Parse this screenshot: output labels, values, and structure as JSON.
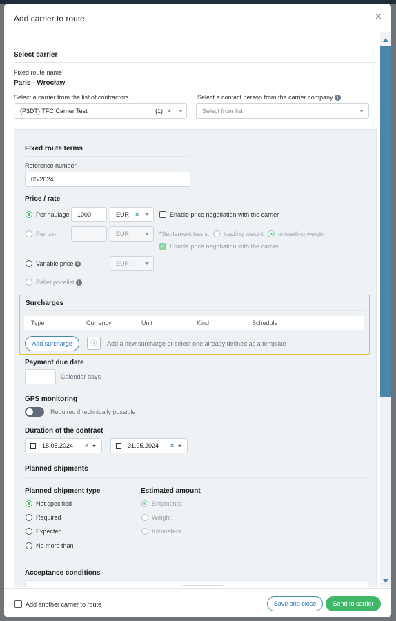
{
  "modal": {
    "title": "Add carrier to route",
    "close": "×"
  },
  "select_carrier": {
    "heading": "Select carrier",
    "route_name_label": "Fixed route name",
    "route_name": "Paris - Wrocław",
    "carrier_label": "Select a carrier from the list of contractors",
    "carrier_value": "(P3DT) TFC Carrier Test",
    "carrier_count": "(1)",
    "contact_label": "Select a contact person from the carrier company",
    "contact_placeholder": "Select from list"
  },
  "terms": {
    "heading": "Fixed route terms",
    "ref_label": "Reference number",
    "ref_value": "05/2024",
    "price_heading": "Price / rate",
    "per_haulage": "Per haulage",
    "per_haulage_value": "1000",
    "currency": "EUR",
    "enable_negotiation": "Enable price negotiation with the carrier",
    "per_ton": "Per ton",
    "settlement_basis": "Settlement basis:",
    "loading_weight": "loading weight",
    "unloading_weight": "unloading weight",
    "enable_negotiation_2": "Enable price negotiation with the carrier",
    "variable_price": "Variable price",
    "pallet_pricelist": "Pallet pricelist"
  },
  "surcharges": {
    "heading": "Surcharges",
    "columns": [
      "Type",
      "Currency",
      "Unit",
      "Kind",
      "Schedule"
    ],
    "add_button": "Add surcharge",
    "hint": "Add a new surcharge or select one already defined as a template"
  },
  "payment": {
    "heading": "Payment due date",
    "unit": "Calendar days"
  },
  "gps": {
    "heading": "GPS monitoring",
    "toggle_label": "Required if technically possible"
  },
  "duration": {
    "heading": "Duration of the contract",
    "start": "15.05.2024",
    "end": "31.05.2024",
    "sep": "-"
  },
  "planned": {
    "heading": "Planned shipments",
    "type_heading": "Planned shipment type",
    "types": [
      "Not specified",
      "Required",
      "Expected",
      "No more than"
    ],
    "amount_heading": "Estimated amount",
    "amounts": [
      "Shipments",
      "Weight",
      "Kilometers"
    ]
  },
  "acceptance": {
    "heading": "Acceptance conditions"
  },
  "footer": {
    "add_another": "Add another carrier to route",
    "save_close": "Save and close",
    "send": "Send to carrier"
  },
  "colors": {
    "accent": "#3fb868",
    "link": "#2f74b5",
    "highlight": "#e2c23c",
    "scroll": "#4a86a8"
  }
}
